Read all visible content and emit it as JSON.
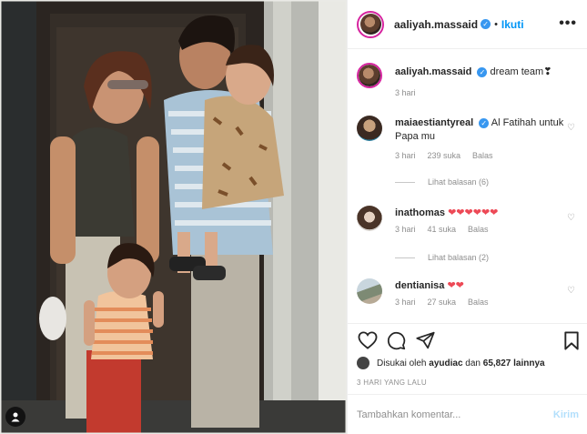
{
  "post": {
    "author": "aaliyah.massaid",
    "follow_label": "Ikuti",
    "dot": "•",
    "more_glyph": "•••",
    "verified_glyph": "✓"
  },
  "caption": {
    "username": "aaliyah.massaid",
    "text": "dream team❣",
    "time": "3 hari"
  },
  "comments": [
    {
      "username": "maiaestiantyreal",
      "text": "Al Fatihah untuk Papa mu",
      "time": "3 hari",
      "likes": "239 suka",
      "reply": "Balas",
      "view_replies": "Lihat balasan (6)"
    },
    {
      "username": "inathomas",
      "text": "❤❤❤❤❤❤",
      "time": "3 hari",
      "likes": "41 suka",
      "reply": "Balas",
      "view_replies": "Lihat balasan (2)"
    },
    {
      "username": "dentianisa",
      "text": "❤❤",
      "time": "3 hari",
      "likes": "27 suka",
      "reply": "Balas"
    }
  ],
  "likes": {
    "prefix": "Disukai oleh",
    "user": "ayudiac",
    "joiner": "dan",
    "others": "65,827 lainnya"
  },
  "timestamp": "3 HARI YANG LALU",
  "composer": {
    "placeholder": "Tambahkan komentar...",
    "post_label": "Kirim"
  },
  "icons": {
    "heart": "heart-icon",
    "comment": "comment-icon",
    "share": "share-icon",
    "save": "bookmark-icon",
    "tag": "user-tag-icon"
  },
  "colors": {
    "link_blue": "#0095f6",
    "verified_blue": "#3897f0",
    "heart_red": "#ed4956",
    "muted": "#8e8e8e"
  }
}
